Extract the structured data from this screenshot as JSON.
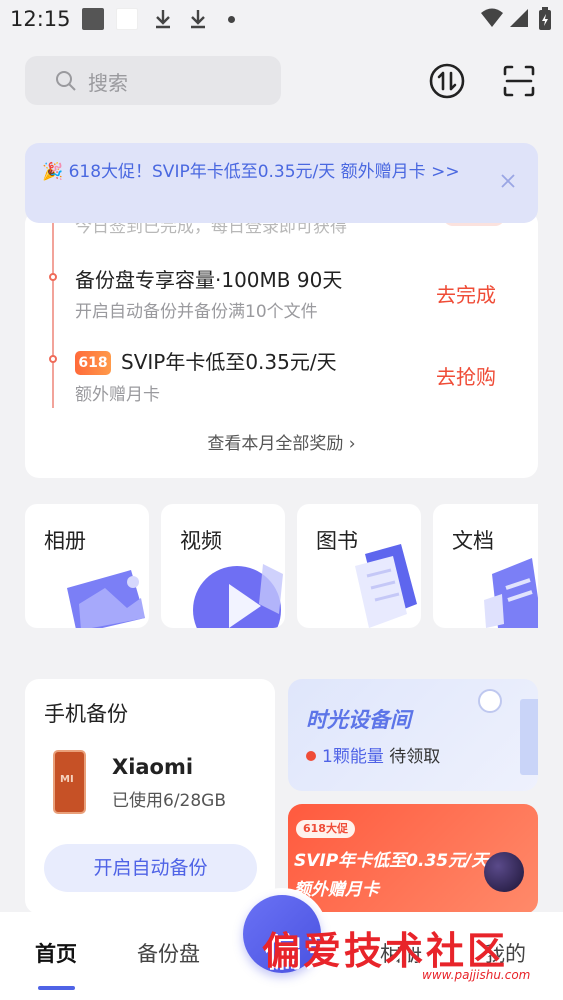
{
  "status_bar": {
    "time": "12:15"
  },
  "top_bar": {
    "search_placeholder": "搜索"
  },
  "promo_banner": {
    "text": "🎉 618大促！SVIP年卡低至0.35元/天 额外赠月卡 >>"
  },
  "tasks": {
    "cut_text": "今日签到已完成，每日登录即可获得",
    "items": [
      {
        "title": "备份盘专享容量·100MB 90天",
        "subtitle": "开启自动备份并备份满10个文件",
        "action": "去完成"
      },
      {
        "tag": "618",
        "title": "SVIP年卡低至0.35元/天",
        "subtitle": "额外赠月卡",
        "action": "去抢购"
      }
    ],
    "view_all": "查看本月全部奖励 ›"
  },
  "categories": [
    {
      "label": "相册",
      "icon": "photo-album-icon"
    },
    {
      "label": "视频",
      "icon": "video-play-icon"
    },
    {
      "label": "图书",
      "icon": "book-icon"
    },
    {
      "label": "文档",
      "icon": "document-icon"
    }
  ],
  "backup": {
    "title": "手机备份",
    "device_name": "Xiaomi",
    "usage": "已使用6/28GB",
    "button": "开启自动备份",
    "phone_brand": "MI"
  },
  "time_device": {
    "title": "时光设备间",
    "energy_count": "1颗能量",
    "energy_status": "待领取"
  },
  "promo_card": {
    "badge": "618大促",
    "line1": "SVIP年卡低至0.35元/天",
    "line2": "额外赠月卡"
  },
  "bottom_nav": {
    "items": [
      "首页",
      "备份盘",
      "",
      "相册",
      "我的"
    ]
  },
  "watermark": {
    "text": "偏爱技术社区",
    "url": "www.pajjishu.com"
  },
  "colors": {
    "accent": "#4f63e6",
    "action_red": "#ef4c37",
    "background": "#f2f2f4"
  }
}
